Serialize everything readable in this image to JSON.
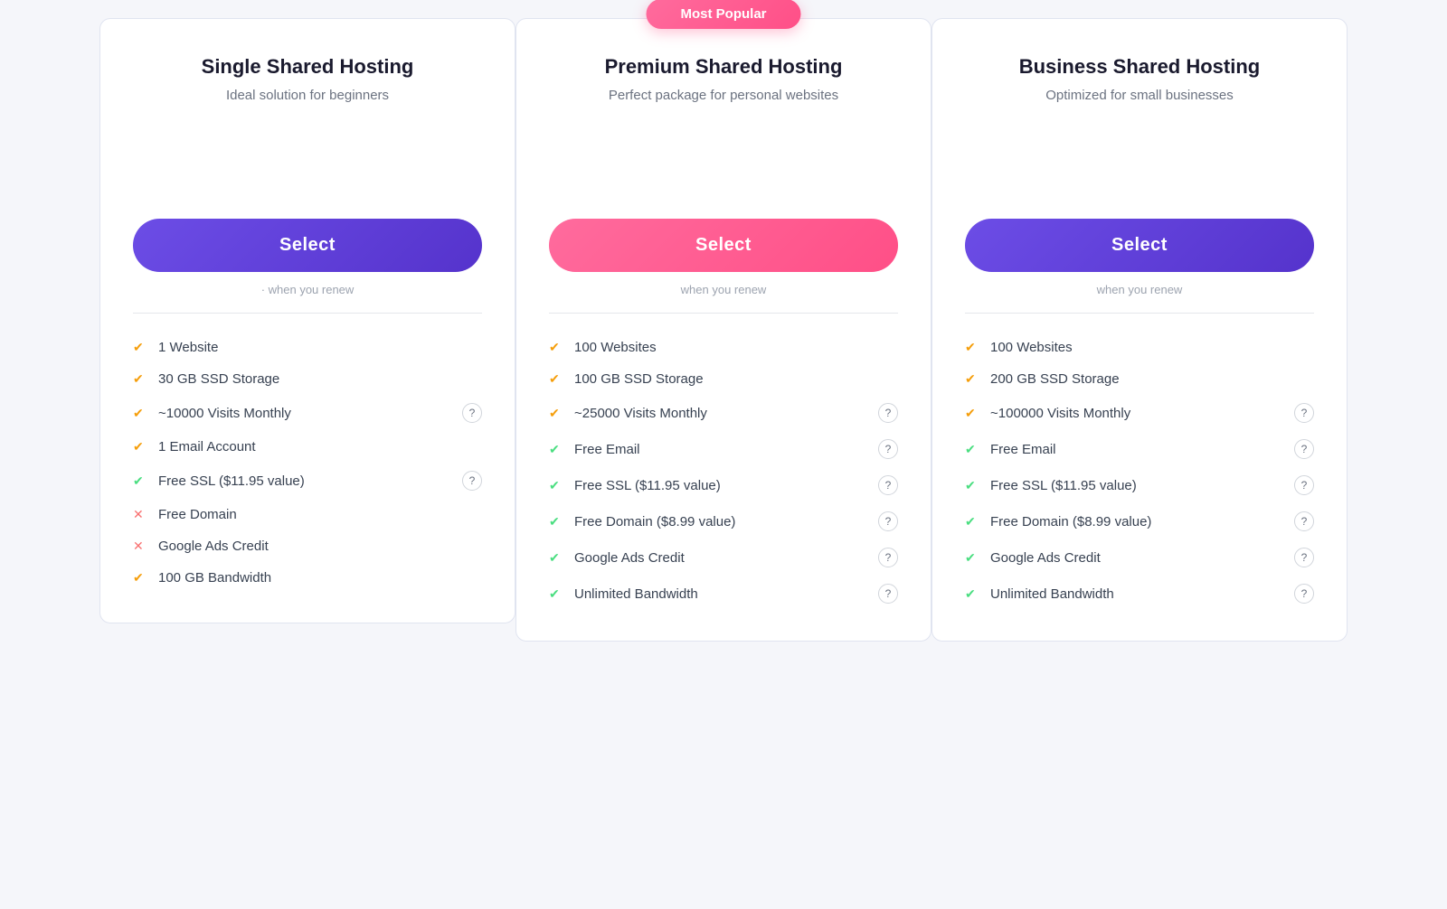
{
  "badge": {
    "label": "Most Popular"
  },
  "plans": [
    {
      "id": "single",
      "name": "Single Shared Hosting",
      "subtitle": "Ideal solution for beginners",
      "button_label": "Select",
      "button_style": "purple",
      "renew_text": "· when you renew",
      "features": [
        {
          "icon": "gold-check",
          "text": "1 Website",
          "info": false
        },
        {
          "icon": "gold-check",
          "text": "30 GB SSD Storage",
          "info": false
        },
        {
          "icon": "gold-check",
          "text": "~10000 Visits Monthly",
          "info": true
        },
        {
          "icon": "gold-check",
          "text": "1 Email Account",
          "info": false
        },
        {
          "icon": "green-check",
          "text": "Free SSL ($11.95 value)",
          "info": true
        },
        {
          "icon": "cross",
          "text": "Free Domain",
          "info": false
        },
        {
          "icon": "cross",
          "text": "Google Ads Credit",
          "info": false
        },
        {
          "icon": "gold-check",
          "text": "100 GB Bandwidth",
          "info": false
        }
      ]
    },
    {
      "id": "premium",
      "name": "Premium Shared Hosting",
      "subtitle": "Perfect package for personal websites",
      "button_label": "Select",
      "button_style": "pink",
      "renew_text": "when you renew",
      "popular": true,
      "features": [
        {
          "icon": "gold-check",
          "text": "100 Websites",
          "info": false
        },
        {
          "icon": "gold-check",
          "text": "100 GB SSD Storage",
          "info": false
        },
        {
          "icon": "gold-check",
          "text": "~25000 Visits Monthly",
          "info": true
        },
        {
          "icon": "green-check",
          "text": "Free Email",
          "info": true
        },
        {
          "icon": "green-check",
          "text": "Free SSL ($11.95 value)",
          "info": true
        },
        {
          "icon": "green-check",
          "text": "Free Domain ($8.99 value)",
          "info": true
        },
        {
          "icon": "green-check",
          "text": "Google Ads Credit",
          "info": true
        },
        {
          "icon": "green-check",
          "text": "Unlimited Bandwidth",
          "info": true
        }
      ]
    },
    {
      "id": "business",
      "name": "Business Shared Hosting",
      "subtitle": "Optimized for small businesses",
      "button_label": "Select",
      "button_style": "purple",
      "renew_text": "when you renew",
      "features": [
        {
          "icon": "gold-check",
          "text": "100 Websites",
          "info": false
        },
        {
          "icon": "gold-check",
          "text": "200 GB SSD Storage",
          "info": false
        },
        {
          "icon": "gold-check",
          "text": "~100000 Visits Monthly",
          "info": true
        },
        {
          "icon": "green-check",
          "text": "Free Email",
          "info": true
        },
        {
          "icon": "green-check",
          "text": "Free SSL ($11.95 value)",
          "info": true
        },
        {
          "icon": "green-check",
          "text": "Free Domain ($8.99 value)",
          "info": true
        },
        {
          "icon": "green-check",
          "text": "Google Ads Credit",
          "info": true
        },
        {
          "icon": "green-check",
          "text": "Unlimited Bandwidth",
          "info": true
        }
      ]
    }
  ]
}
